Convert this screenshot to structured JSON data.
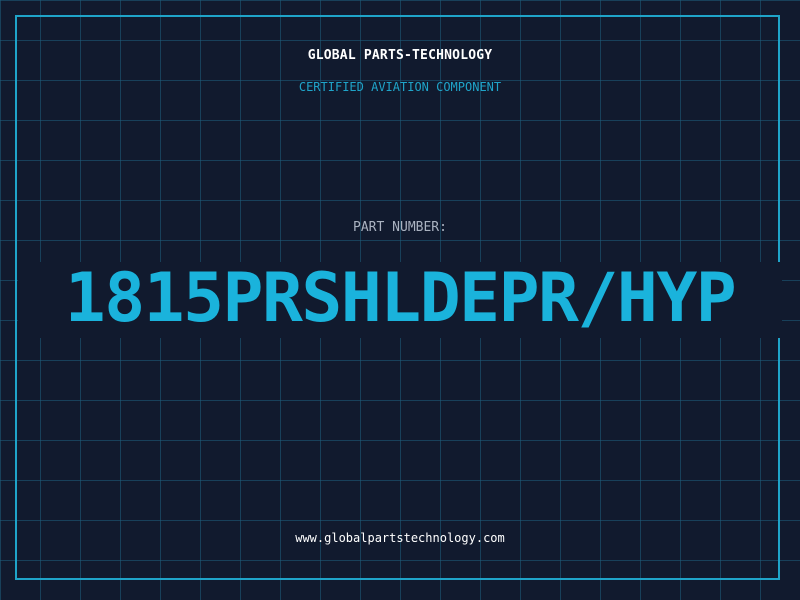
{
  "header": {
    "company": "GLOBAL PARTS-TECHNOLOGY",
    "tagline": "CERTIFIED AVIATION COMPONENT"
  },
  "part": {
    "label": "PART NUMBER:",
    "number": "1815PRSHLDEPR/HYP"
  },
  "footer": {
    "website": "www.globalpartstechnology.com"
  },
  "colors": {
    "background": "#111a2e",
    "grid": "#1e5f7d",
    "accent": "#1fa4c9",
    "part_number": "#1ab3dc",
    "label": "#aab2c0",
    "text": "#ffffff"
  }
}
